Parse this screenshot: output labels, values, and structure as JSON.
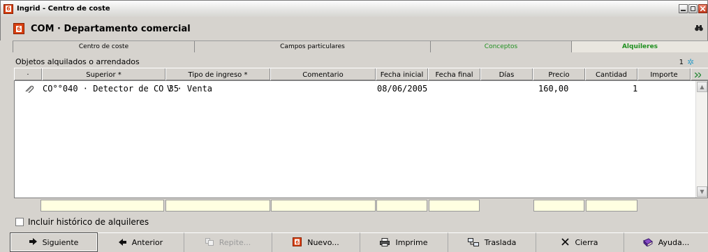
{
  "window": {
    "title": "Ingrid - Centro de coste",
    "app_icon_label": "6"
  },
  "header": {
    "title": "COM · Departamento comercial"
  },
  "tabs": [
    {
      "label": "Centro de coste"
    },
    {
      "label": "Campos particulares"
    },
    {
      "label": "Conceptos"
    },
    {
      "label": "Alquileres"
    }
  ],
  "section": {
    "label": "Objetos alquilados o arrendados",
    "count": "1"
  },
  "grid": {
    "columns": [
      "·",
      "Superior *",
      "Tipo de ingreso *",
      "Comentario",
      "Fecha inicial",
      "Fecha final",
      "Días",
      "Precio",
      "Cantidad",
      "Importe"
    ],
    "rows": [
      {
        "superior": "CO°°040 · Detector de CO 35",
        "tipo": "V · Venta",
        "comentario": "",
        "fecha_inicial": "08/06/2005",
        "fecha_final": "",
        "dias": "",
        "precio": "160,00",
        "cantidad": "1",
        "importe": ""
      }
    ]
  },
  "checkbox": {
    "label": "Incluir histórico de alquileres",
    "checked": false
  },
  "buttons": [
    {
      "label": "Siguiente",
      "icon": "arrow-right-icon"
    },
    {
      "label": "Anterior",
      "icon": "arrow-left-icon"
    },
    {
      "label": "Repite...",
      "icon": "repeat-icon"
    },
    {
      "label": "Nuevo...",
      "icon": "new-icon"
    },
    {
      "label": "Imprime",
      "icon": "printer-icon"
    },
    {
      "label": "Traslada",
      "icon": "transfer-icon"
    },
    {
      "label": "Cierra",
      "icon": "close-icon"
    },
    {
      "label": "Ayuda...",
      "icon": "help-book-icon"
    }
  ],
  "colors": {
    "active_tab_text": "#1f8f1f",
    "totals_field_bg": "#ffffe1"
  }
}
